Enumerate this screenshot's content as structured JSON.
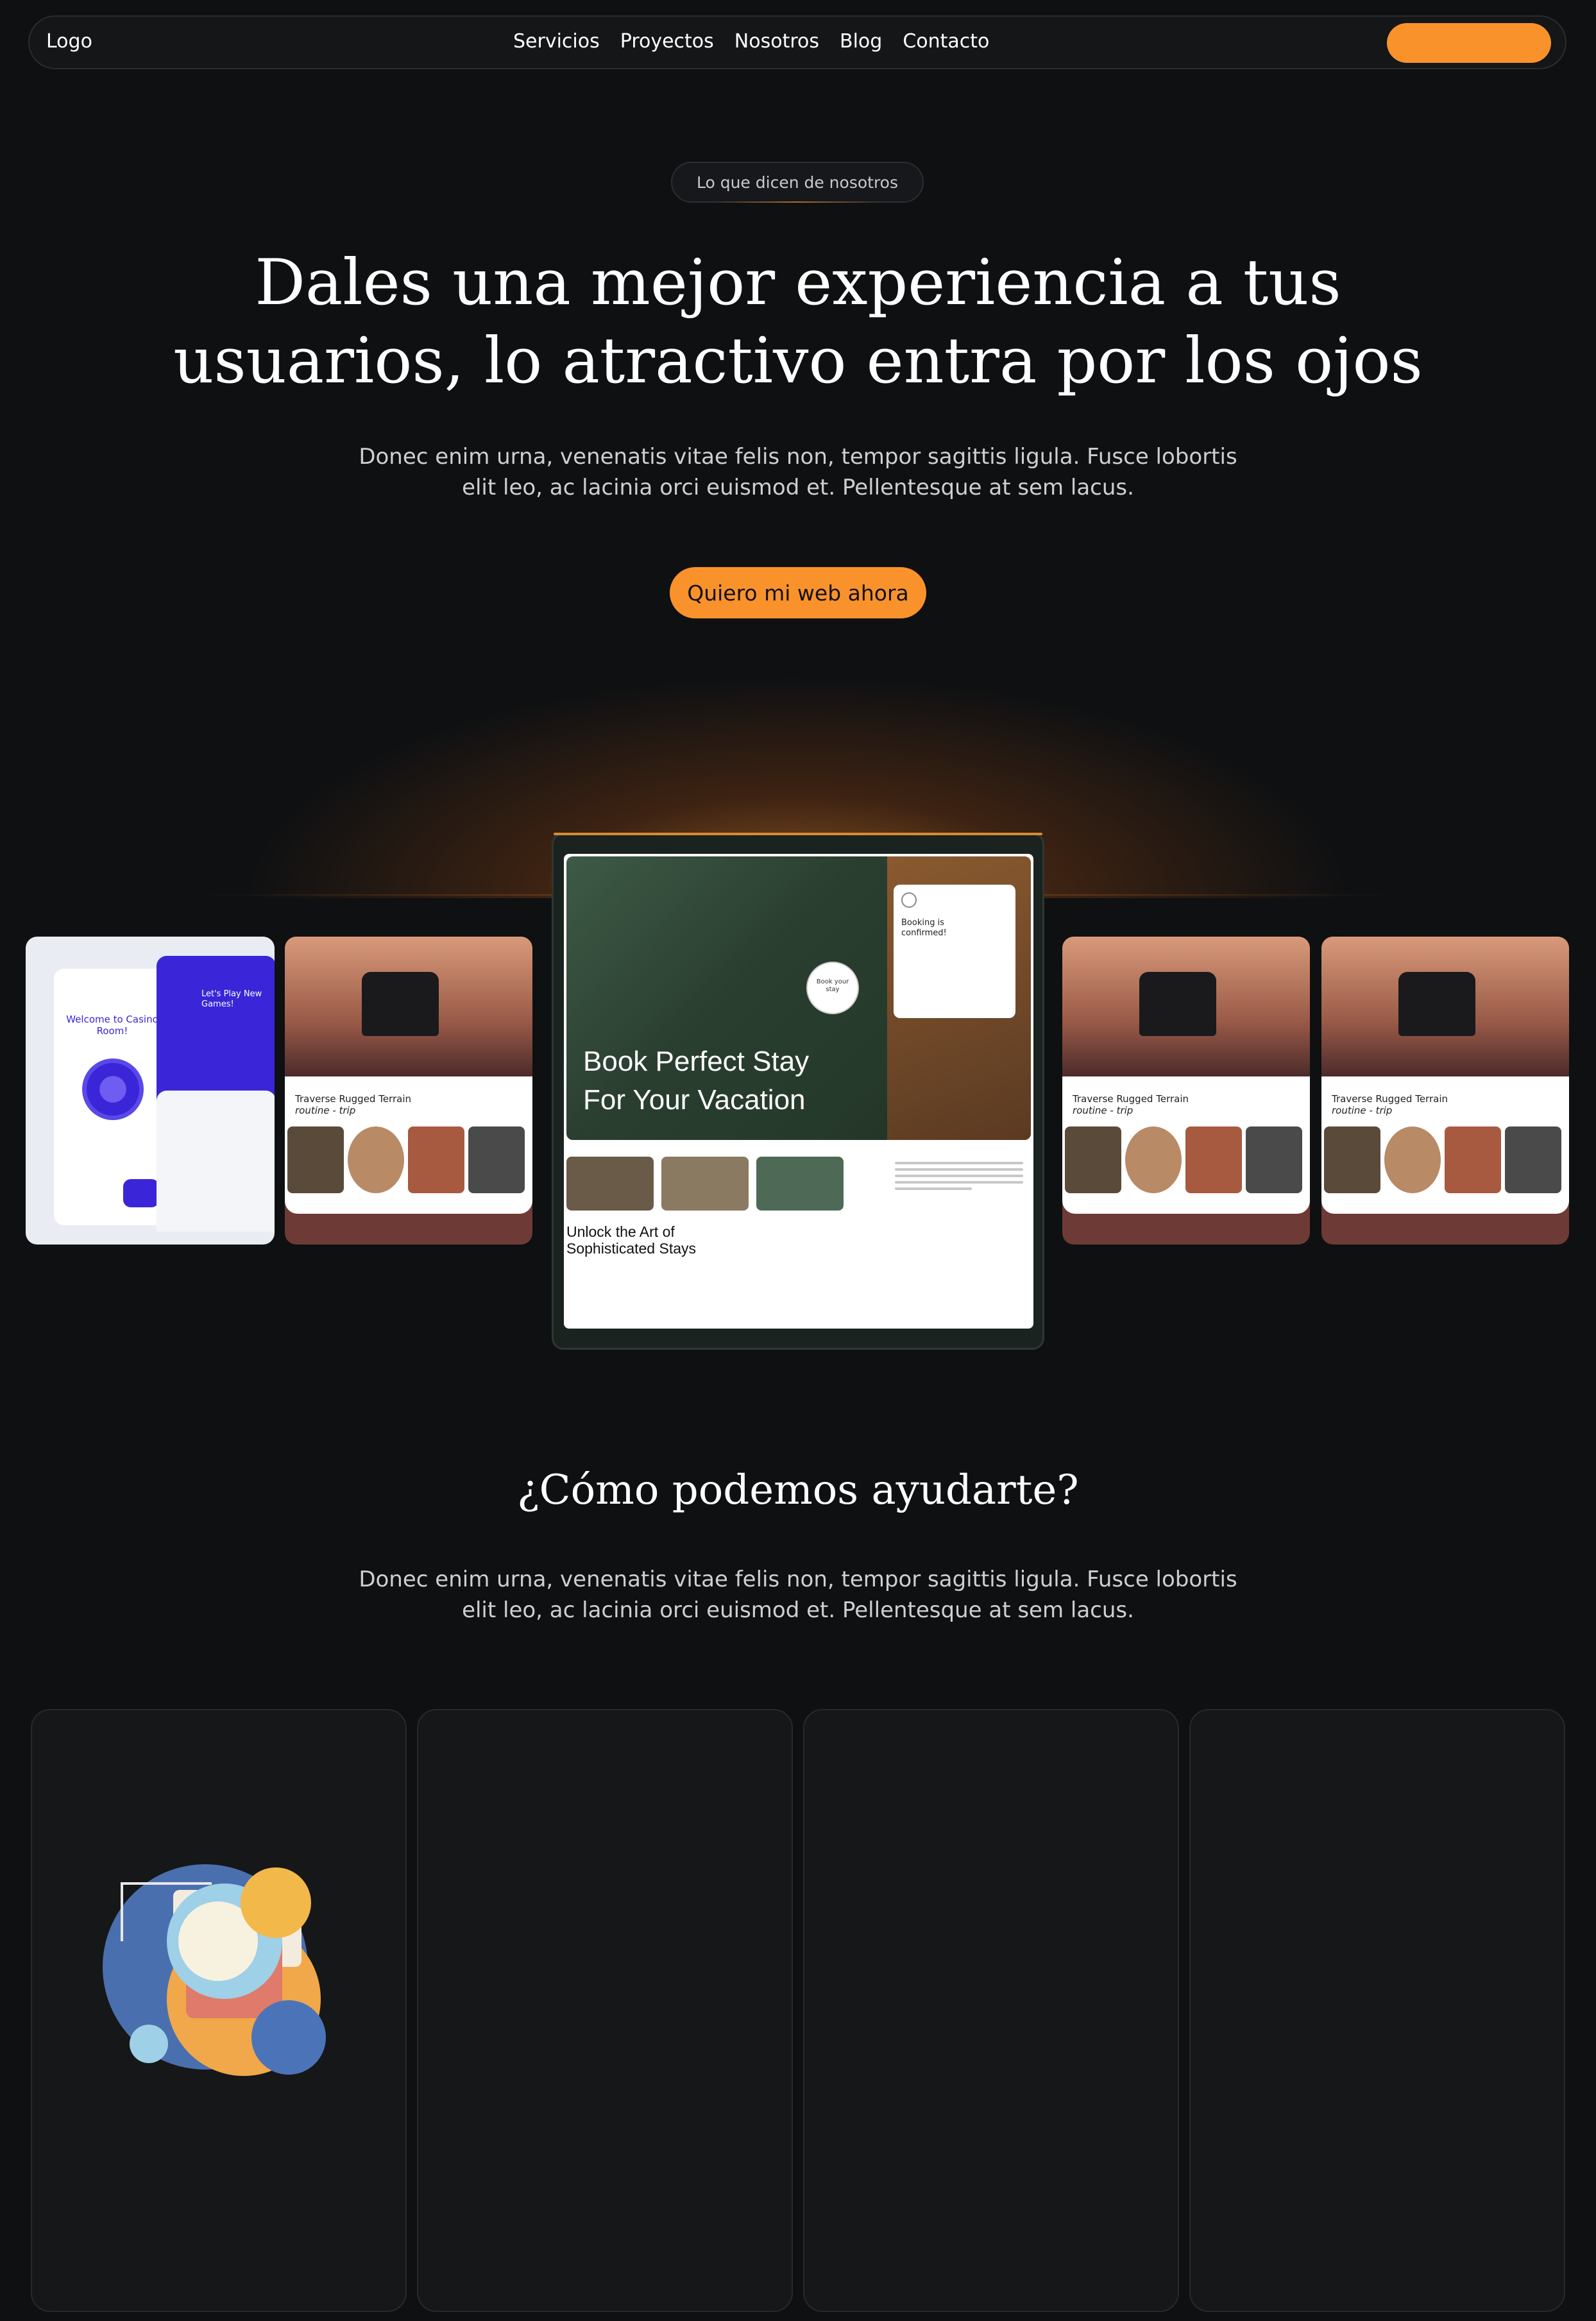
{
  "nav": {
    "logo": "Logo",
    "items": [
      "Servicios",
      "Proyectos",
      "Nosotros",
      "Blog",
      "Contacto"
    ],
    "cta_label": ""
  },
  "hero": {
    "eyebrow": "Lo que dicen de nosotros",
    "title": "Dales una mejor experiencia a tus usuarios, lo atractivo entra por los ojos",
    "description": "Donec enim urna, venenatis vitae felis non, tempor sagittis ligula. Fusce lobortis elit leo, ac lacinia orci euismod et. Pellentesque at sem lacus.",
    "cta": "Quiero mi web ahora"
  },
  "showcase": {
    "casino": {
      "welcome": "Welcome to Casino Room!",
      "play": "Let's Play New Games!"
    },
    "camping": {
      "title": "Traverse Rugged Terrain",
      "subtitle": "routine - trip"
    },
    "tablet": {
      "hero_title": "Book Perfect Stay For Your Vacation",
      "booking_card": "Booking is confirmed!",
      "unlock_title": "Unlock the Art of Sophisticated Stays",
      "book_button": "Book your stay"
    }
  },
  "services": {
    "title": "¿Cómo podemos ayudarte?",
    "description": "Donec enim urna, venenatis vitae felis non, tempor sagittis ligula. Fusce lobortis elit leo, ac lacinia orci euismod et. Pellentesque at sem lacus.",
    "cards": [
      {
        "icon": "abstract-shapes-icon"
      },
      {},
      {},
      {}
    ]
  },
  "colors": {
    "accent": "#fa922c",
    "background": "#0e1012",
    "card": "#161718"
  }
}
